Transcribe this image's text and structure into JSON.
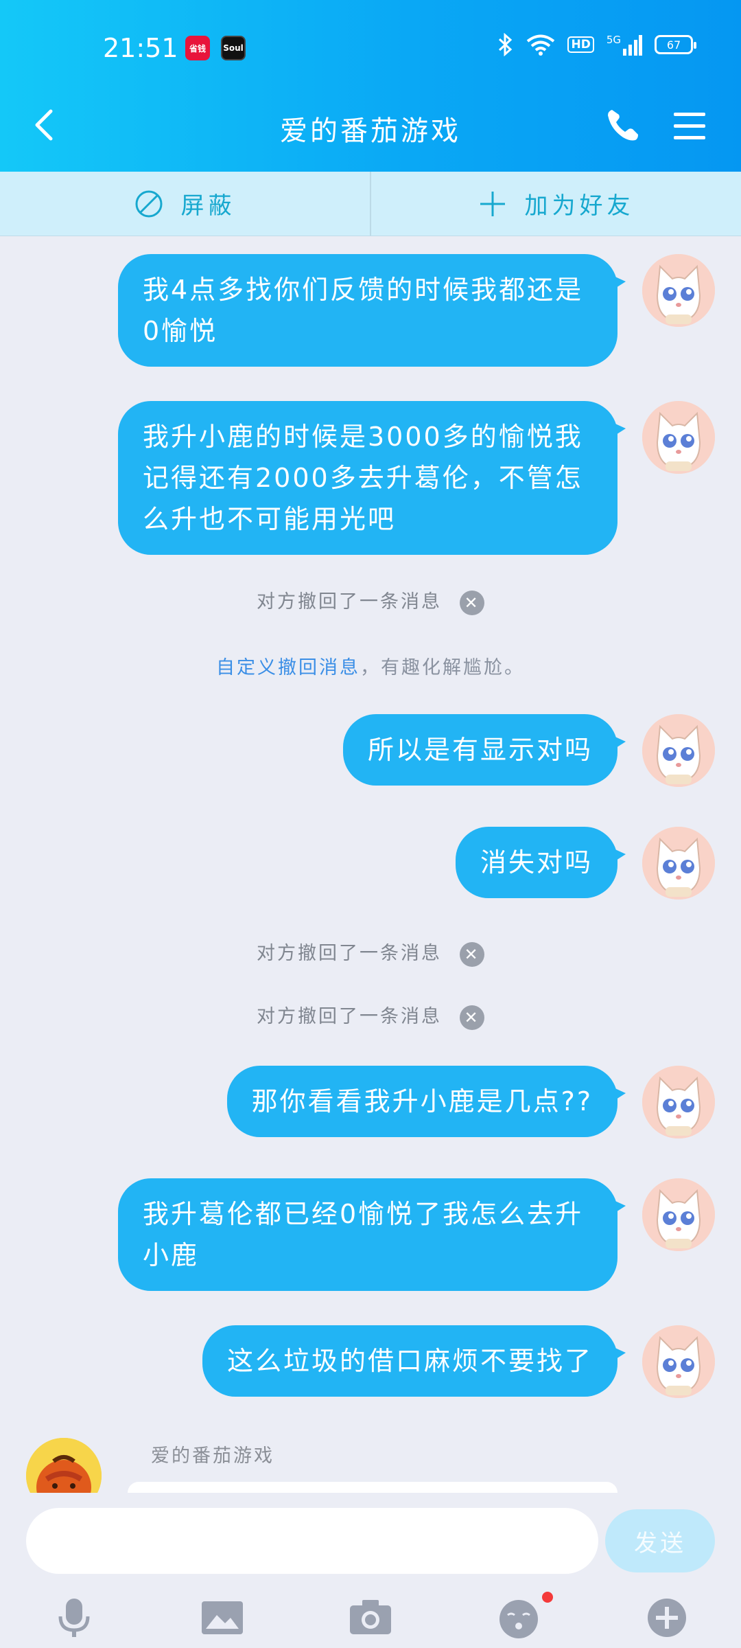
{
  "status_bar": {
    "time": "21:51",
    "badge_1": "省钱",
    "badge_2": "Soul",
    "hd": "HD",
    "network": "5G",
    "battery": "67"
  },
  "header": {
    "title": "爱的番茄游戏"
  },
  "actions": {
    "block_label": "屏蔽",
    "add_friend_label": "加为好友"
  },
  "messages": [
    {
      "text": "我4点多找你们反馈的时候我都还是0愉悦"
    },
    {
      "text": "我升小鹿的时候是3000多的愉悦我记得还有2000多去升葛伦，不管怎么升也不可能用光吧"
    },
    {
      "text": "所以是有显示对吗"
    },
    {
      "text": "消失对吗"
    },
    {
      "text": "那你看看我升小鹿是几点??"
    },
    {
      "text": "我升葛伦都已经0愉悦了我怎么去升小鹿"
    },
    {
      "text": "这么垃圾的借口麻烦不要找了"
    }
  ],
  "system": {
    "recalled_1": "对方撤回了一条消息",
    "recalled_2": "对方撤回了一条消息",
    "recalled_3": "对方撤回了一条消息",
    "tip_link": "自定义撤回消息",
    "tip_rest": "，有趣化解尴尬。"
  },
  "incoming": {
    "sender_name": "爱的番茄游戏"
  },
  "input": {
    "placeholder": "",
    "send_label": "发送"
  },
  "toolbar": {
    "icons": [
      "microphone-icon",
      "image-icon",
      "camera-icon",
      "emoji-icon",
      "plus-icon"
    ]
  },
  "colors": {
    "accent": "#22b4f4",
    "header": "#0aa8f5",
    "background": "#ebedf5",
    "action_text": "#17a8cf",
    "notification_dot": "#f43a3a"
  }
}
